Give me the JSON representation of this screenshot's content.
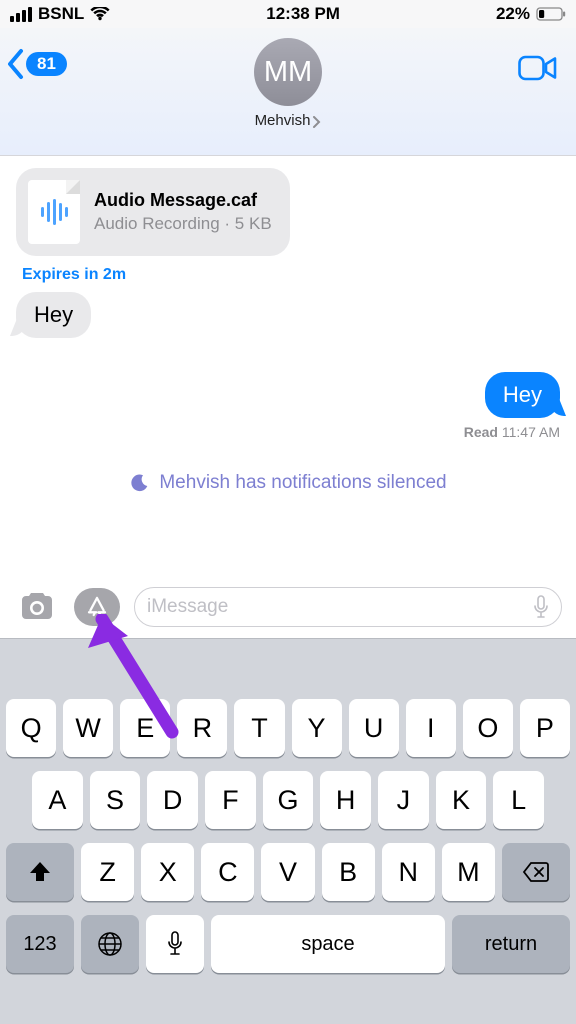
{
  "status": {
    "carrier": "BSNL",
    "time": "12:38 PM",
    "battery_pct": "22%"
  },
  "header": {
    "back_count": "81",
    "initials": "MM",
    "contact_name": "Mehvish"
  },
  "chat": {
    "attachment": {
      "filename": "Audio Message.caf",
      "subtitle": "Audio Recording · 5 KB"
    },
    "expires": "Expires in 2m",
    "incoming_text": "Hey",
    "outgoing_text": "Hey",
    "read_label": "Read",
    "read_time": "11:47 AM",
    "silenced": "Mehvish has notifications silenced"
  },
  "input": {
    "placeholder": "iMessage"
  },
  "keyboard": {
    "row1": [
      "Q",
      "W",
      "E",
      "R",
      "T",
      "Y",
      "U",
      "I",
      "O",
      "P"
    ],
    "row2": [
      "A",
      "S",
      "D",
      "F",
      "G",
      "H",
      "J",
      "K",
      "L"
    ],
    "row3": [
      "Z",
      "X",
      "C",
      "V",
      "B",
      "N",
      "M"
    ],
    "num": "123",
    "space": "space",
    "ret": "return"
  }
}
